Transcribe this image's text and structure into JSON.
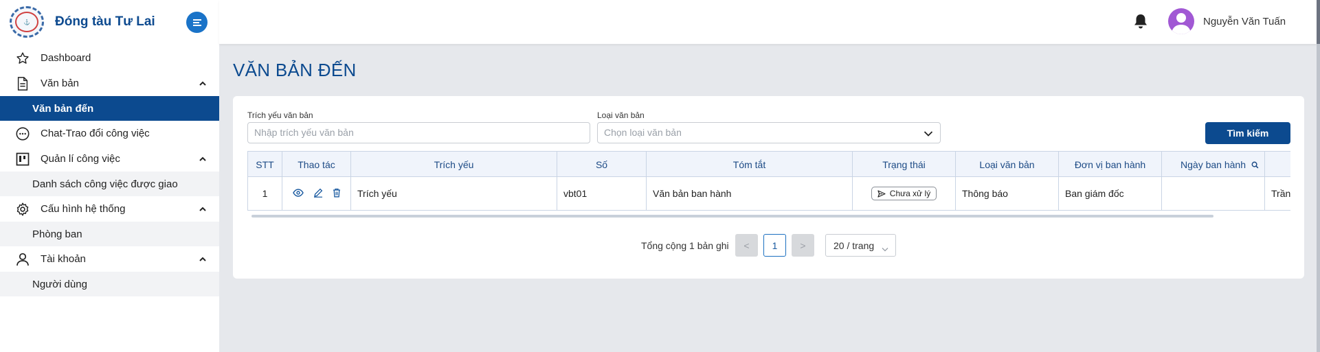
{
  "brand": {
    "name": "Đóng tàu Tư Lai",
    "logo_text": "Tư Lai shipyard"
  },
  "sidebar": {
    "items": [
      {
        "label": "Dashboard",
        "icon": "star-icon"
      },
      {
        "label": "Văn bản",
        "icon": "document-icon",
        "expanded": true,
        "children": [
          {
            "label": "Văn bản đến",
            "active": true
          }
        ]
      },
      {
        "label": "Chat-Trao đổi công việc",
        "icon": "chat-icon"
      },
      {
        "label": "Quản lí công việc",
        "icon": "kanban-icon",
        "expanded": true,
        "children": [
          {
            "label": "Danh sách công việc được giao"
          }
        ]
      },
      {
        "label": "Cấu hình hệ thống",
        "icon": "gear-icon",
        "expanded": true,
        "children": [
          {
            "label": "Phòng ban"
          }
        ]
      },
      {
        "label": "Tài khoản",
        "icon": "user-icon",
        "expanded": true,
        "children": [
          {
            "label": "Người dùng"
          }
        ]
      }
    ]
  },
  "header": {
    "user_name": "Nguyễn Văn Tuấn"
  },
  "page": {
    "title": "VĂN BẢN ĐẾN"
  },
  "filters": {
    "summary_label": "Trích yếu văn bản",
    "summary_placeholder": "Nhập trích yếu văn bản",
    "type_label": "Loại văn bản",
    "type_placeholder": "Chọn loại văn bản",
    "search_button": "Tìm kiếm"
  },
  "table": {
    "columns": [
      "STT",
      "Thao tác",
      "Trích yếu",
      "Số",
      "Tóm tắt",
      "Trạng thái",
      "Loại văn bản",
      "Đơn vị ban hành",
      "Ngày ban hành",
      ""
    ],
    "rows": [
      {
        "stt": "1",
        "trich_yeu": "Trích yếu",
        "so": "vbt01",
        "tom_tat": "Văn bản ban hành",
        "trang_thai": "Chưa xử lý",
        "loai": "Thông báo",
        "don_vi": "Ban giám đốc",
        "ngay": "",
        "extra": "Trần"
      }
    ]
  },
  "pagination": {
    "total_text": "Tổng cộng 1 bản ghi",
    "prev": "<",
    "current": "1",
    "next": ">",
    "page_size": "20 / trang"
  },
  "colors": {
    "primary": "#0c4a8f",
    "accent": "#1a73c8",
    "avatar": "#a158d4",
    "header_bg": "#f0f4fb",
    "page_bg": "#e6e8ec"
  }
}
